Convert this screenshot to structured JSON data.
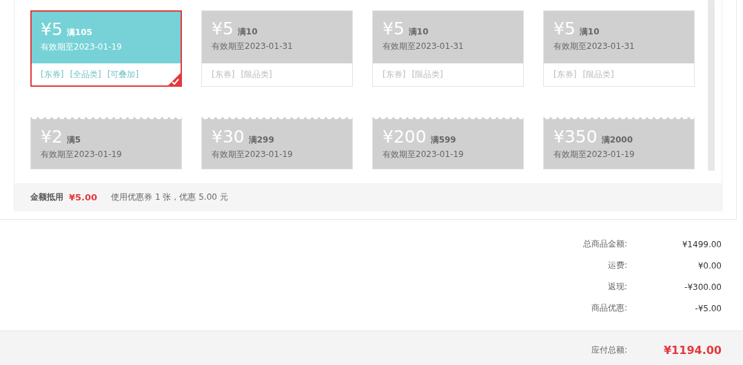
{
  "coupons": [
    {
      "amount": "¥5",
      "threshold": "满105",
      "expiry": "有效期至2023-01-19",
      "tags": [
        "[东券]",
        "[全品类]",
        "[可叠加]"
      ],
      "available": true,
      "selected": true,
      "kind": "plain"
    },
    {
      "amount": "¥5",
      "threshold": "满10",
      "expiry": "有效期至2023-01-31",
      "tags": [
        "[东券]",
        "[限品类]"
      ],
      "available": false,
      "selected": false,
      "kind": "plain"
    },
    {
      "amount": "¥5",
      "threshold": "满10",
      "expiry": "有效期至2023-01-31",
      "tags": [
        "[东券]",
        "[限品类]"
      ],
      "available": false,
      "selected": false,
      "kind": "plain"
    },
    {
      "amount": "¥5",
      "threshold": "满10",
      "expiry": "有效期至2023-01-31",
      "tags": [
        "[东券]",
        "[限品类]"
      ],
      "available": false,
      "selected": false,
      "kind": "plain"
    },
    {
      "amount": "¥2",
      "threshold": "满5",
      "expiry": "有效期至2023-01-19",
      "available": false,
      "selected": false,
      "kind": "wavy"
    },
    {
      "amount": "¥30",
      "threshold": "满299",
      "expiry": "有效期至2023-01-19",
      "available": false,
      "selected": false,
      "kind": "wavy"
    },
    {
      "amount": "¥200",
      "threshold": "满599",
      "expiry": "有效期至2023-01-19",
      "available": false,
      "selected": false,
      "kind": "wavy"
    },
    {
      "amount": "¥350",
      "threshold": "满2000",
      "expiry": "有效期至2023-01-19",
      "available": false,
      "selected": false,
      "kind": "wavy"
    }
  ],
  "coupon_summary": {
    "label": "金额抵用",
    "amount": "¥5.00",
    "note": "使用优惠券 1 张，优惠 5.00 元"
  },
  "totals": [
    {
      "label": "总商品金额:",
      "value": "¥1499.00"
    },
    {
      "label": "运费:",
      "value": "¥0.00"
    },
    {
      "label": "返现:",
      "value": "-¥300.00"
    },
    {
      "label": "商品优惠:",
      "value": "-¥5.00"
    }
  ],
  "payable": {
    "label": "应付总额:",
    "value": "¥1194.00"
  }
}
